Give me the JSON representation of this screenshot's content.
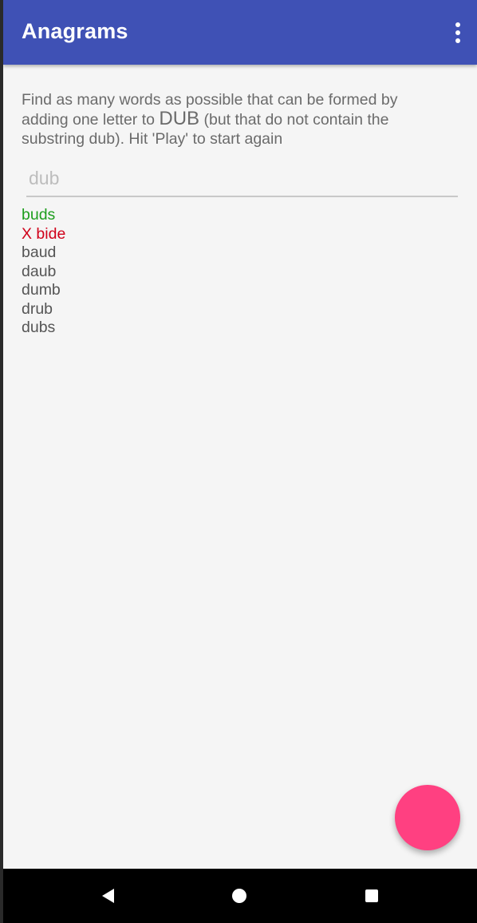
{
  "app_bar": {
    "title": "Anagrams",
    "overflow_icon": "more-vert-icon",
    "color": "#3f51b5"
  },
  "instructions": {
    "part1": "Find as many words as possible that can be formed by adding one letter to ",
    "word": "DUB",
    "part2": " (but that do not contain the substring dub). Hit 'Play' to start again"
  },
  "input": {
    "value": "",
    "placeholder": "dub"
  },
  "guesses": [
    {
      "text": "buds",
      "status": "correct",
      "color": "#1e9e1e"
    },
    {
      "text": "X bide",
      "status": "wrong",
      "color": "#d0021b"
    },
    {
      "text": "baud",
      "status": "answer",
      "color": "#555555"
    },
    {
      "text": "daub",
      "status": "answer",
      "color": "#555555"
    },
    {
      "text": "dumb",
      "status": "answer",
      "color": "#555555"
    },
    {
      "text": "drub",
      "status": "answer",
      "color": "#555555"
    },
    {
      "text": "dubs",
      "status": "answer",
      "color": "#555555"
    }
  ],
  "fab": {
    "icon": "play-icon",
    "color": "#ff4081"
  },
  "nav_bar": {
    "back_icon": "back-triangle-icon",
    "home_icon": "home-circle-icon",
    "recents_icon": "recents-square-icon"
  }
}
